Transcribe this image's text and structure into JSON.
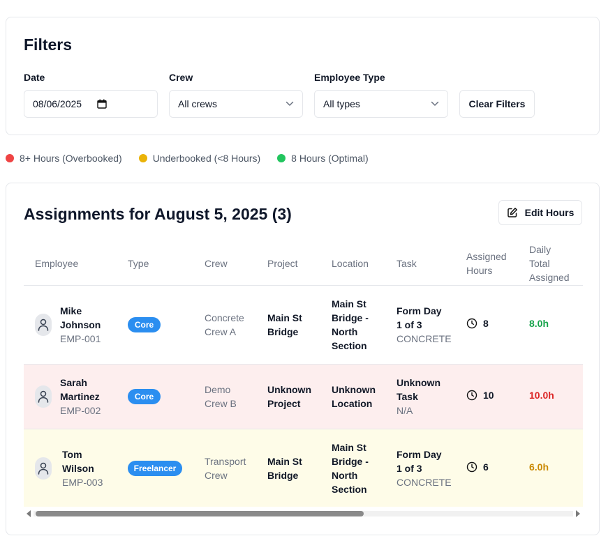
{
  "filters": {
    "title": "Filters",
    "date_label": "Date",
    "date_value": "08/06/2025",
    "crew_label": "Crew",
    "crew_value": "All crews",
    "type_label": "Employee Type",
    "type_value": "All types",
    "clear_label": "Clear Filters"
  },
  "legend": [
    {
      "label": "8+ Hours (Overbooked)",
      "color": "#ef4444"
    },
    {
      "label": "Underbooked (<8 Hours)",
      "color": "#eab308"
    },
    {
      "label": "8 Hours (Optimal)",
      "color": "#22c55e"
    }
  ],
  "assignments": {
    "title": "Assignments for August 5, 2025 (3)",
    "edit_label": "Edit Hours",
    "columns": {
      "employee": "Employee",
      "type": "Type",
      "crew": "Crew",
      "project": "Project",
      "location": "Location",
      "task": "Task",
      "assigned_1": "Assigned",
      "assigned_2": "Hours",
      "daily_1": "Daily",
      "daily_2": "Total",
      "daily_3": "Assigned"
    },
    "rows": [
      {
        "name_1": "Mike",
        "name_2": "Johnson",
        "emp_id": "EMP-001",
        "type": "Core",
        "crew_1": "Concrete",
        "crew_2": "Crew A",
        "project_1": "Main St",
        "project_2": "Bridge",
        "location": [
          "Main St",
          "Bridge -",
          "North",
          "Section"
        ],
        "task_1": "Form Day",
        "task_2": "1 of 3",
        "task_sub": "CONCRETE",
        "hours": "8",
        "total": "8.0h",
        "row_bg": "#ffffff",
        "total_color": "#16a34a"
      },
      {
        "name_1": "Sarah",
        "name_2": "Martinez",
        "emp_id": "EMP-002",
        "type": "Core",
        "crew_1": "Demo",
        "crew_2": "Crew B",
        "project_1": "Unknown",
        "project_2": "Project",
        "location": [
          "Unknown",
          "Location"
        ],
        "task_1": "Unknown",
        "task_2": "Task",
        "task_sub": "N/A",
        "hours": "10",
        "total": "10.0h",
        "row_bg": "#fdeeee",
        "total_color": "#dc2626"
      },
      {
        "name_1": "Tom",
        "name_2": "Wilson",
        "emp_id": "EMP-003",
        "type": "Freelancer",
        "crew_1": "Transport",
        "crew_2": "Crew",
        "project_1": "Main St",
        "project_2": "Bridge",
        "location": [
          "Main St",
          "Bridge -",
          "North",
          "Section"
        ],
        "task_1": "Form Day",
        "task_2": "1 of 3",
        "task_sub": "CONCRETE",
        "hours": "6",
        "total": "6.0h",
        "row_bg": "#fefce8",
        "total_color": "#ca8a04"
      }
    ]
  },
  "icons": {
    "calendar": "calendar-icon",
    "chevron": "chevron-down-icon",
    "edit": "edit-icon",
    "user": "user-icon",
    "clock": "clock-icon"
  }
}
